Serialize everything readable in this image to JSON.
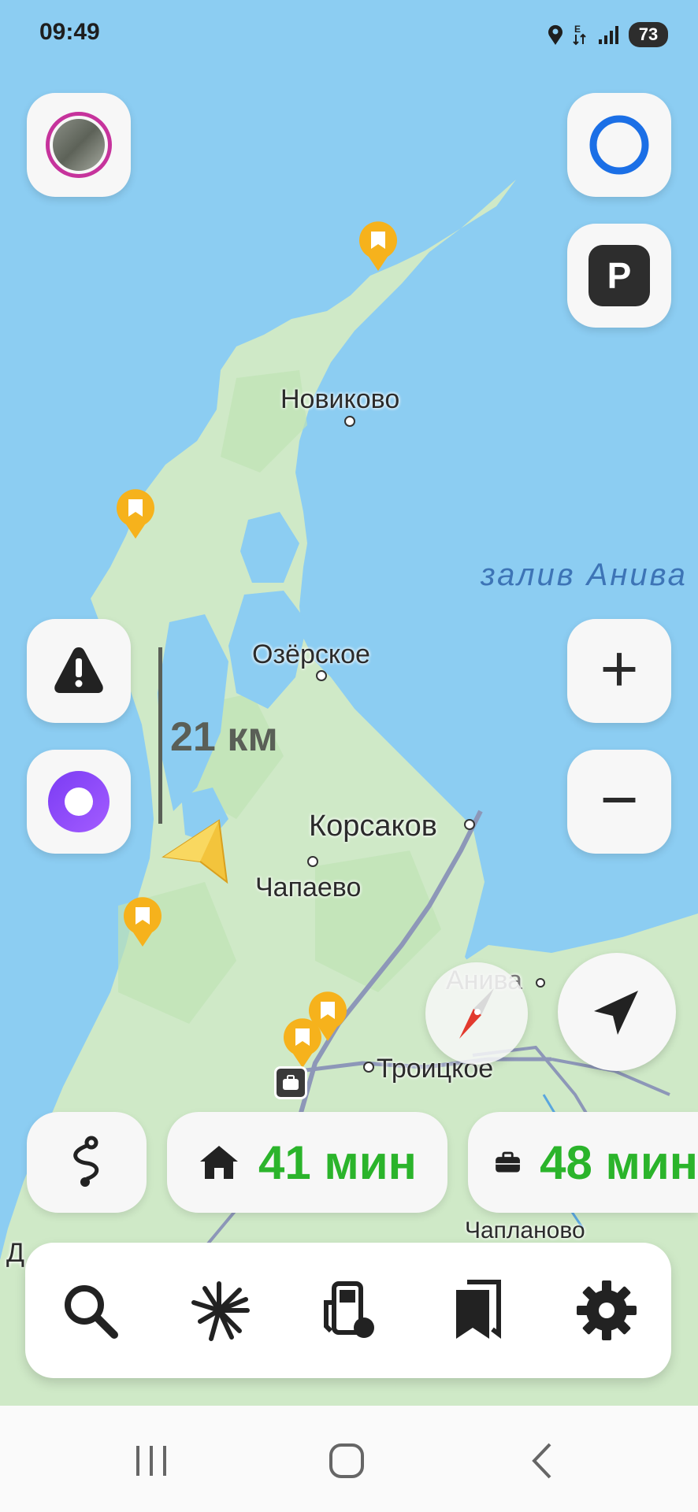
{
  "status_bar": {
    "time": "09:49",
    "battery": "73"
  },
  "map": {
    "places": {
      "novikovo": "Новиково",
      "ozerskoe": "Озёрское",
      "korsakov": "Корсаков",
      "chapaevo": "Чапаево",
      "aniva": "Анива",
      "troitskoe": "Троицкое",
      "chaplanovo": "Чапланово",
      "partial_d": "Д"
    },
    "sea": "залив Анива",
    "scale": "21 км"
  },
  "buttons": {
    "parking": "P",
    "zoom_in": "+",
    "zoom_out": "−"
  },
  "routes": {
    "home_time": "41 мин",
    "work_time": "48 мин"
  },
  "toolbar_items": [
    "search-icon",
    "discover-icon",
    "gas-station-icon",
    "bookmarks-icon",
    "settings-icon"
  ],
  "colors": {
    "route_time": "#2bb42b",
    "water": "#8ccdf2",
    "land": "#cfe9c7"
  }
}
